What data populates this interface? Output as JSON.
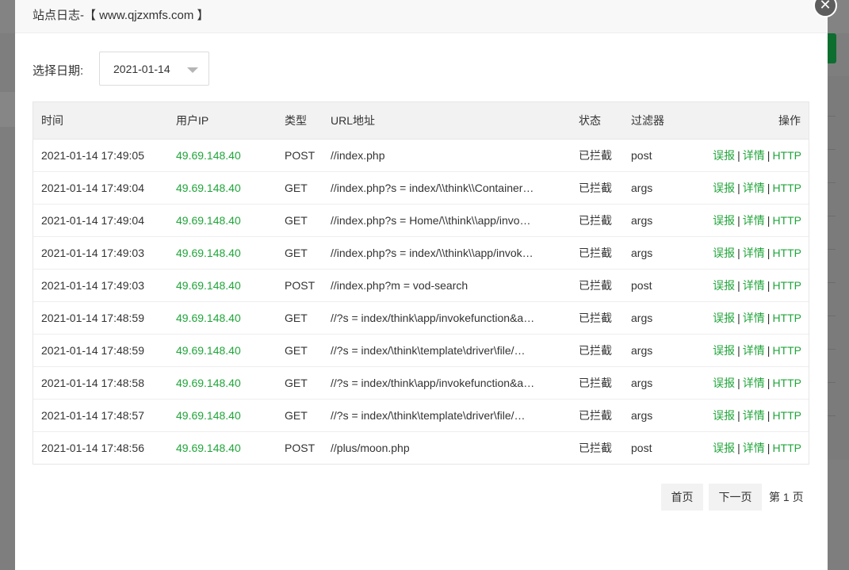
{
  "modal": {
    "title": "站点日志-【 www.qjzxmfs.com 】",
    "close_glyph": "✕"
  },
  "filter": {
    "label": "选择日期:",
    "date_value": "2021-01-14"
  },
  "table": {
    "columns": [
      "时间",
      "用户IP",
      "类型",
      "URL地址",
      "状态",
      "过滤器",
      "操作"
    ],
    "rows": [
      {
        "time": "2021-01-14 17:49:05",
        "ip": "49.69.148.40",
        "type": "POST",
        "url": "//index.php",
        "status": "已拦截",
        "filter": "post"
      },
      {
        "time": "2021-01-14 17:49:04",
        "ip": "49.69.148.40",
        "type": "GET",
        "url": "//index.php?s = index/\\\\think\\\\Container…",
        "status": "已拦截",
        "filter": "args"
      },
      {
        "time": "2021-01-14 17:49:04",
        "ip": "49.69.148.40",
        "type": "GET",
        "url": "//index.php?s = Home/\\\\think\\\\app/invo…",
        "status": "已拦截",
        "filter": "args"
      },
      {
        "time": "2021-01-14 17:49:03",
        "ip": "49.69.148.40",
        "type": "GET",
        "url": "//index.php?s = index/\\\\think\\\\app/invok…",
        "status": "已拦截",
        "filter": "args"
      },
      {
        "time": "2021-01-14 17:49:03",
        "ip": "49.69.148.40",
        "type": "POST",
        "url": "//index.php?m = vod-search",
        "status": "已拦截",
        "filter": "post"
      },
      {
        "time": "2021-01-14 17:48:59",
        "ip": "49.69.148.40",
        "type": "GET",
        "url": "//?s = index/think\\app/invokefunction&a…",
        "status": "已拦截",
        "filter": "args"
      },
      {
        "time": "2021-01-14 17:48:59",
        "ip": "49.69.148.40",
        "type": "GET",
        "url": "//?s = index/\\think\\template\\driver\\file/…",
        "status": "已拦截",
        "filter": "args"
      },
      {
        "time": "2021-01-14 17:48:58",
        "ip": "49.69.148.40",
        "type": "GET",
        "url": "//?s = index/think\\app/invokefunction&a…",
        "status": "已拦截",
        "filter": "args"
      },
      {
        "time": "2021-01-14 17:48:57",
        "ip": "49.69.148.40",
        "type": "GET",
        "url": "//?s = index/\\think\\template\\driver\\file/…",
        "status": "已拦截",
        "filter": "args"
      },
      {
        "time": "2021-01-14 17:48:56",
        "ip": "49.69.148.40",
        "type": "POST",
        "url": "//plus/moon.php",
        "status": "已拦截",
        "filter": "post"
      }
    ],
    "actions": {
      "report": "误报",
      "detail": "详情",
      "http": "HTTP",
      "separator": "|"
    }
  },
  "pagination": {
    "first": "首页",
    "next": "下一页",
    "current": "第 1 页"
  },
  "colors": {
    "accent_green": "#20a53a",
    "header_bg": "#f8f8f8"
  }
}
